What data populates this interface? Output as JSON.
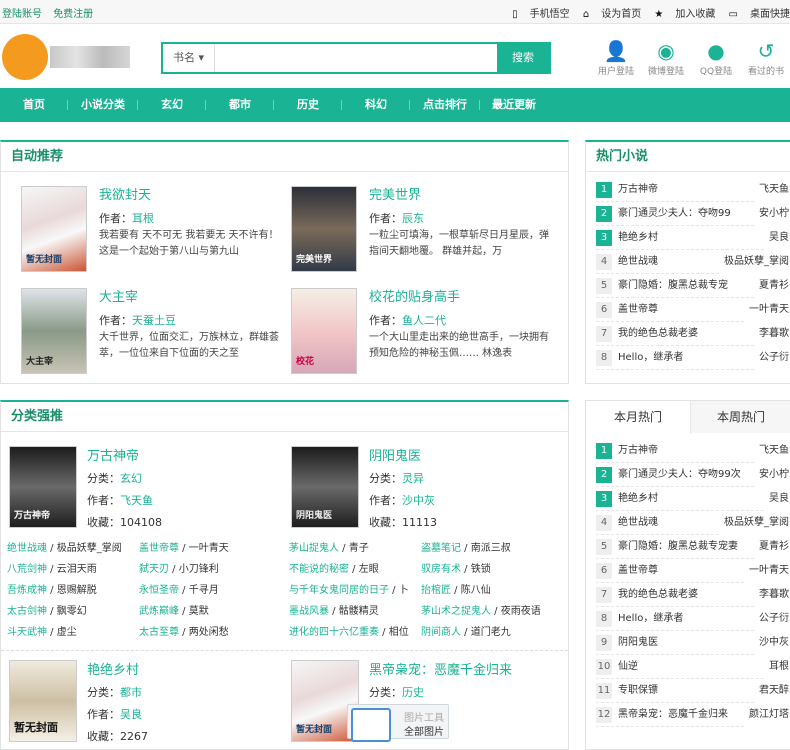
{
  "topbar": {
    "login": "登陆账号",
    "register": "免费注册",
    "mobile": "手机悟空",
    "homepage": "设为首页",
    "favorite": "加入收藏",
    "desktop": "桌面快捷"
  },
  "search": {
    "select": "书名",
    "button": "搜索"
  },
  "header_icons": [
    {
      "icon": "user-icon",
      "label": "用户登陆"
    },
    {
      "icon": "weibo-icon",
      "label": "微博登陆"
    },
    {
      "icon": "qq-icon",
      "label": "QQ登陆"
    },
    {
      "icon": "history-icon",
      "label": "看过的书"
    }
  ],
  "nav": [
    "首页",
    "小说分类",
    "玄幻",
    "都市",
    "历史",
    "科幻",
    "点击排行",
    "最近更新"
  ],
  "auto_rec": {
    "title": "自动推荐",
    "items": [
      {
        "title": "我欲封天",
        "author_label": "作者：",
        "author": "耳根",
        "desc": "我若要有 天不可无 我若要无 天不许有！ 这是一个起始于第八山与第九山",
        "cover_text": "暂无封面"
      },
      {
        "title": "完美世界",
        "author_label": "作者：",
        "author": "辰东",
        "desc": "一粒尘可填海，一根草斩尽日月星辰，弹指间天翻地覆。 群雄并起，万",
        "cover_text": "完美世界"
      },
      {
        "title": "大主宰",
        "author_label": "作者：",
        "author": "天蚕土豆",
        "desc": "大千世界，位面交汇，万族林立，群雄荟萃，一位位来自下位面的天之至",
        "cover_text": "大主宰"
      },
      {
        "title": "校花的贴身高手",
        "author_label": "作者：",
        "author": "鱼人二代",
        "desc": "一个大山里走出来的绝世高手，一块拥有预知危险的神秘玉佩…… 林逸表",
        "cover_text": "校花"
      }
    ]
  },
  "hot_novels": {
    "title": "热门小说",
    "items": [
      {
        "n": "1",
        "name": "万古神帝",
        "author": "飞天鱼"
      },
      {
        "n": "2",
        "name": "豪门通灵少夫人：夺吻99",
        "author": "安小柠"
      },
      {
        "n": "3",
        "name": "艳绝乡村",
        "author": "吴良"
      },
      {
        "n": "4",
        "name": "绝世战魂",
        "author": "极品妖孽_掌阅"
      },
      {
        "n": "5",
        "name": "豪门隐婚：腹黑总裁专宠",
        "author": "夏青衫"
      },
      {
        "n": "6",
        "name": "盖世帝尊",
        "author": "一叶青天"
      },
      {
        "n": "7",
        "name": "我的绝色总裁老婆",
        "author": "李暮歌"
      },
      {
        "n": "8",
        "name": "Hello，继承者",
        "author": "公子衍"
      }
    ]
  },
  "category": {
    "title": "分类强推",
    "books": [
      {
        "title": "万古神帝",
        "cat_label": "分类：",
        "cat": "玄幻",
        "author_label": "作者：",
        "author": "飞天鱼",
        "fav_label": "收藏：",
        "fav": "104108",
        "cover_text": "万古神帝"
      },
      {
        "title": "阴阳鬼医",
        "cat_label": "分类：",
        "cat": "灵异",
        "author_label": "作者：",
        "author": "沙中灰",
        "fav_label": "收藏：",
        "fav": "11113",
        "cover_text": "阴阳鬼医"
      },
      {
        "title": "艳绝乡村",
        "cat_label": "分类：",
        "cat": "都市",
        "author_label": "作者：",
        "author": "吴良",
        "fav_label": "收藏：",
        "fav": "2267",
        "cover_text": "暂无封面"
      },
      {
        "title": "黑帝枭宠：恶魔千金归来",
        "cat_label": "分类：",
        "cat": "历史",
        "author_label": "",
        "author": "",
        "fav_label": "",
        "fav": "",
        "cover_text": "暂无封面"
      }
    ],
    "links_left": [
      [
        [
          "绝世战魂",
          "极品妖孽_掌阅"
        ],
        [
          "盖世帝尊",
          "一叶青天"
        ]
      ],
      [
        [
          "八荒剑神",
          "云泪天雨"
        ],
        [
          "弑天刃",
          "小刀锋利"
        ]
      ],
      [
        [
          "吾炼成神",
          "恩赐解脱"
        ],
        [
          "永恒圣帝",
          "千寻月"
        ]
      ],
      [
        [
          "太古剑神",
          "飘零幻"
        ],
        [
          "武炼巅峰",
          "莫默"
        ]
      ],
      [
        [
          "斗天武神",
          "虚尘"
        ],
        [
          "太古至尊",
          "两处闲愁"
        ]
      ]
    ],
    "links_right": [
      [
        [
          "茅山捉鬼人",
          "青子"
        ],
        [
          "盗墓笔记",
          "南派三叔"
        ]
      ],
      [
        [
          "不能说的秘密",
          "左眼"
        ],
        [
          "驭房有术",
          "铁锁"
        ]
      ],
      [
        [
          "与千年女鬼同居的日子",
          "卜"
        ],
        [
          "抬棺匠",
          "陈八仙"
        ]
      ],
      [
        [
          "墨战风暴",
          "骷髅精灵"
        ],
        [
          "茅山术之捉鬼人",
          "夜雨夜语"
        ]
      ],
      [
        [
          "进化的四十六亿重奏",
          "相位"
        ],
        [
          "阴间商人",
          "道门老九"
        ]
      ]
    ]
  },
  "month_hot": {
    "tab_month": "本月热门",
    "tab_week": "本周热门",
    "items": [
      {
        "n": "1",
        "name": "万古神帝",
        "author": "飞天鱼"
      },
      {
        "n": "2",
        "name": "豪门通灵少夫人：夺吻99次",
        "author": "安小柠"
      },
      {
        "n": "3",
        "name": "艳绝乡村",
        "author": "吴良"
      },
      {
        "n": "4",
        "name": "绝世战魂",
        "author": "极品妖孽_掌阅"
      },
      {
        "n": "5",
        "name": "豪门隐婚：腹黑总裁专宠妻",
        "author": "夏青衫"
      },
      {
        "n": "6",
        "name": "盖世帝尊",
        "author": "一叶青天"
      },
      {
        "n": "7",
        "name": "我的绝色总裁老婆",
        "author": "李暮歌"
      },
      {
        "n": "8",
        "name": "Hello，继承者",
        "author": "公子衍"
      },
      {
        "n": "9",
        "name": "阴阳鬼医",
        "author": "沙中灰"
      },
      {
        "n": "10",
        "name": "仙逆",
        "author": "耳根"
      },
      {
        "n": "11",
        "name": "专职保镖",
        "author": "君天醉"
      },
      {
        "n": "12",
        "name": "黑帝枭宠：恶魔千金归来",
        "author": "颜江灯塔"
      }
    ]
  },
  "popup": {
    "top": "图片工具",
    "label": "全部图片"
  }
}
